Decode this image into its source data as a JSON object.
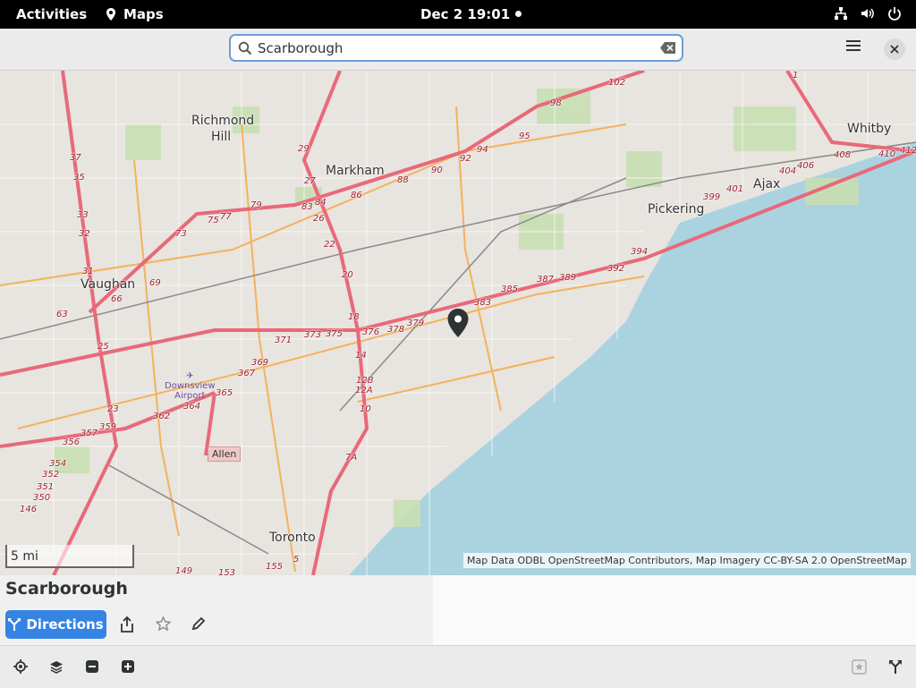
{
  "topbar": {
    "activities": "Activities",
    "app_name": "Maps",
    "clock": "Dec 2  19:01"
  },
  "header": {
    "search_value": "Scarborough"
  },
  "map": {
    "places": [
      {
        "name": "Richmond",
        "cls": "big"
      },
      {
        "name": "Hill",
        "cls": "big"
      },
      {
        "name": "Markham",
        "cls": "big"
      },
      {
        "name": "Vaughan",
        "cls": "big"
      },
      {
        "name": "Pickering",
        "cls": "big"
      },
      {
        "name": "Ajax",
        "cls": "big"
      },
      {
        "name": "Whitby",
        "cls": "big"
      },
      {
        "name": "Toronto",
        "cls": "big"
      }
    ],
    "airport_line1": "Downsview",
    "airport_line2": "Airport",
    "allen_label": "Allen",
    "scale": "5 mi",
    "attribution": "Map Data ODBL OpenStreetMap Contributors, Map Imagery CC-BY-SA 2.0 OpenStreetMap",
    "route_numbers": [
      "102",
      "98",
      "95",
      "94",
      "92",
      "90",
      "88",
      "86",
      "84",
      "83",
      "79",
      "77",
      "75",
      "73",
      "69",
      "66",
      "63",
      "37",
      "35",
      "33",
      "32",
      "31",
      "29",
      "27",
      "26",
      "25",
      "23",
      "22",
      "20",
      "18",
      "14",
      "12B",
      "12A",
      "10",
      "7A",
      "376",
      "378",
      "379",
      "383",
      "385",
      "387",
      "389",
      "392",
      "394",
      "399",
      "401",
      "404",
      "406",
      "408",
      "410",
      "412",
      "371",
      "373",
      "375",
      "369",
      "367",
      "365",
      "364",
      "362",
      "359",
      "357",
      "356",
      "354",
      "352",
      "351",
      "350",
      "146",
      "149",
      "153",
      "155",
      "5",
      "1"
    ]
  },
  "place_panel": {
    "title": "Scarborough",
    "directions_label": "Directions"
  }
}
